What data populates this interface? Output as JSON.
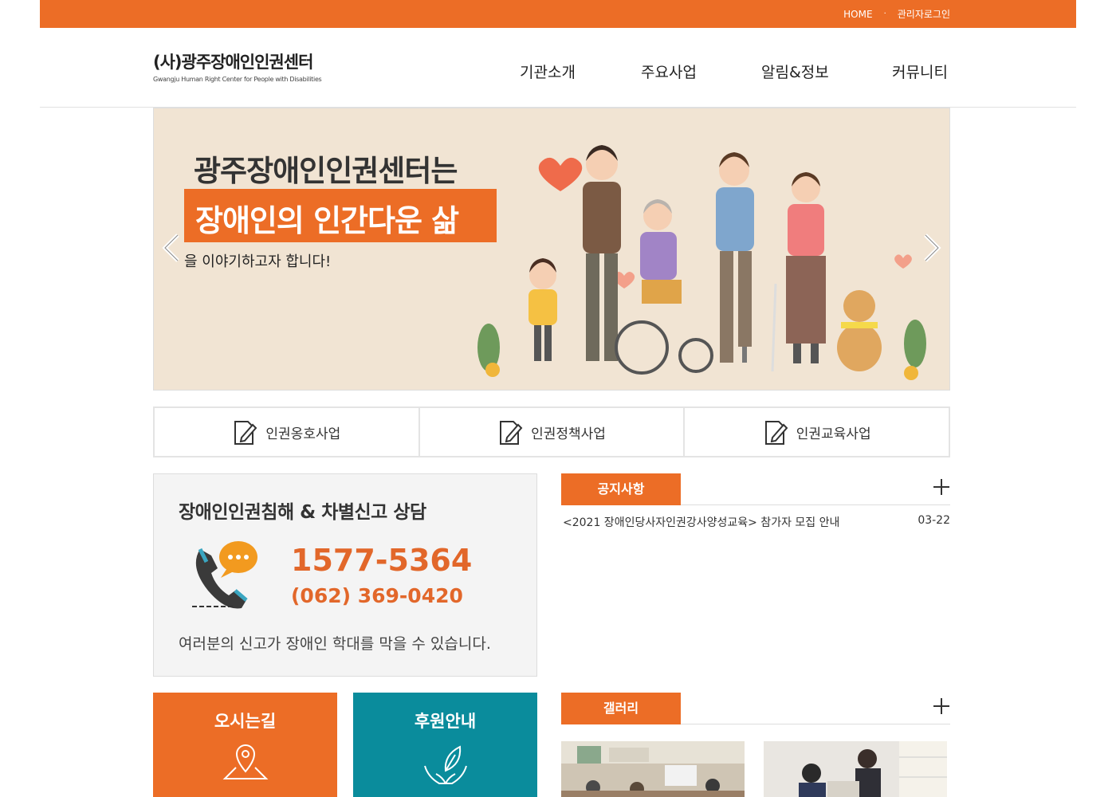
{
  "topbar": {
    "home": "HOME",
    "separator": "·",
    "admin_login": "관리자로그인"
  },
  "logo": {
    "title": "(사)광주장애인인권센터",
    "subtitle": "Gwangju Human Right Center for People with Disabilities"
  },
  "nav": {
    "items": [
      {
        "label": "기관소개"
      },
      {
        "label": "주요사업"
      },
      {
        "label": "알림&정보"
      },
      {
        "label": "커뮤니티"
      }
    ]
  },
  "banner": {
    "line1": "광주장애인인권센터는",
    "line2": "장애인의 인간다운 삶",
    "line3": "을 이야기하고자 합니다!"
  },
  "business": {
    "items": [
      {
        "label": "인권옹호사업",
        "icon": "document-pen-icon"
      },
      {
        "label": "인권정책사업",
        "icon": "document-pen-icon"
      },
      {
        "label": "인권교육사업",
        "icon": "document-pen-icon"
      }
    ]
  },
  "consult": {
    "title": "장애인인권침해 & 차별신고 상담",
    "phone_main": "1577-5364",
    "phone_sub": "(062) 369-0420",
    "description": "여러분의 신고가 장애인 학대를 막을 수 있습니다.",
    "icon": "phone-chat-icon"
  },
  "notice": {
    "tab": "공지사항",
    "items": [
      {
        "title": "<2021 장애인당사자인권강사양성교육> 참가자 모집 안내",
        "date": "03-22"
      }
    ]
  },
  "gallery": {
    "tab": "갤러리"
  },
  "quick": {
    "directions": {
      "label": "오시는길",
      "icon": "map-pin-icon"
    },
    "support": {
      "label": "후원안내",
      "icon": "hands-leaf-icon"
    }
  },
  "colors": {
    "accent": "#ec6d26",
    "teal": "#0a8c9c",
    "banner_bg": "#f1e4d3"
  }
}
